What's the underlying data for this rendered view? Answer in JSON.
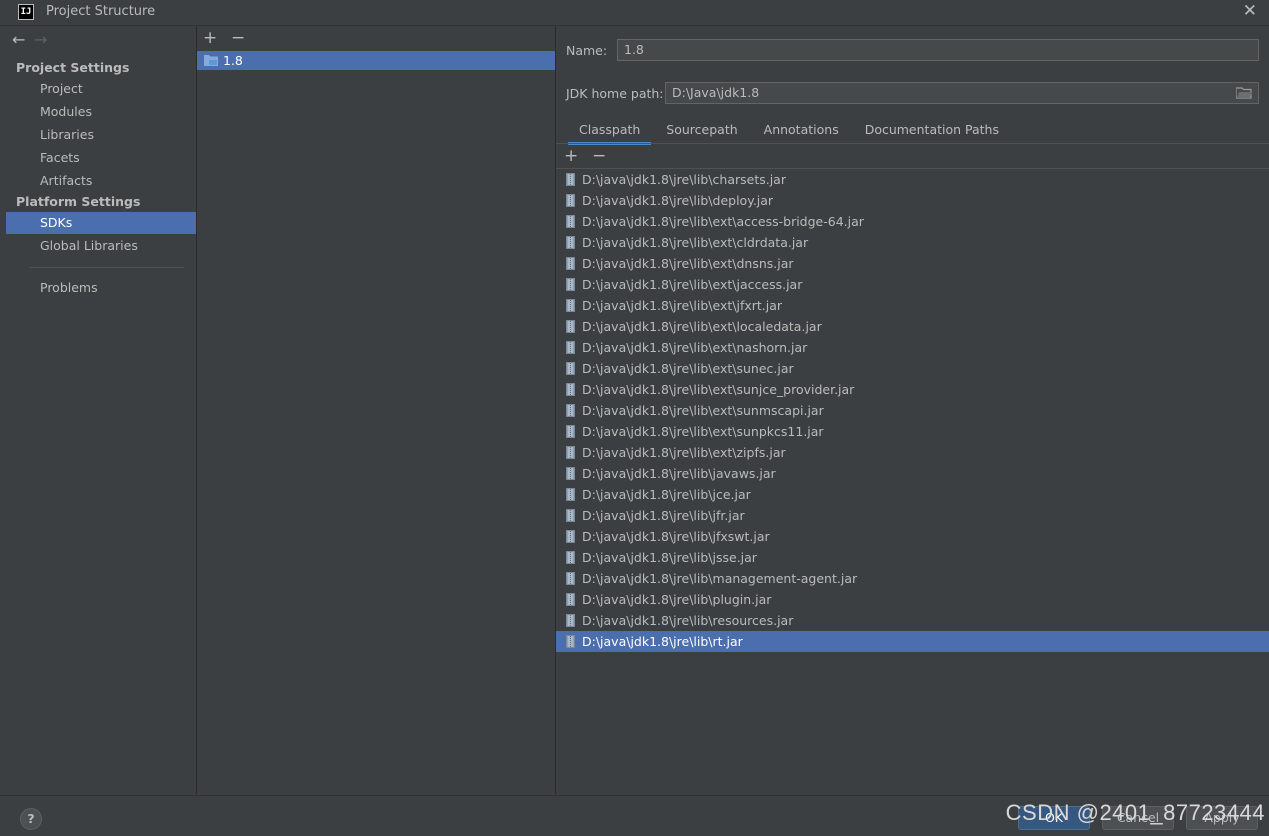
{
  "window": {
    "title": "Project Structure",
    "logo_text": "IJ"
  },
  "nav": {
    "back_glyph": "←",
    "forward_glyph": "→",
    "project_settings_header": "Project Settings",
    "project_items": [
      "Project",
      "Modules",
      "Libraries",
      "Facets",
      "Artifacts"
    ],
    "platform_settings_header": "Platform Settings",
    "platform_items": [
      "SDKs",
      "Global Libraries"
    ],
    "problems": "Problems",
    "selected": "SDKs"
  },
  "sdk_list": {
    "add": "+",
    "remove": "−",
    "items": [
      "1.8"
    ]
  },
  "detail": {
    "name_label": "Name:",
    "name_value": "1.8",
    "home_label": "JDK home path:",
    "home_value": "D:\\Java\\jdk1.8",
    "tabs": [
      "Classpath",
      "Sourcepath",
      "Annotations",
      "Documentation Paths"
    ],
    "active_tab": "Classpath",
    "add": "+",
    "remove": "−",
    "classpath": [
      "D:\\java\\jdk1.8\\jre\\lib\\charsets.jar",
      "D:\\java\\jdk1.8\\jre\\lib\\deploy.jar",
      "D:\\java\\jdk1.8\\jre\\lib\\ext\\access-bridge-64.jar",
      "D:\\java\\jdk1.8\\jre\\lib\\ext\\cldrdata.jar",
      "D:\\java\\jdk1.8\\jre\\lib\\ext\\dnsns.jar",
      "D:\\java\\jdk1.8\\jre\\lib\\ext\\jaccess.jar",
      "D:\\java\\jdk1.8\\jre\\lib\\ext\\jfxrt.jar",
      "D:\\java\\jdk1.8\\jre\\lib\\ext\\localedata.jar",
      "D:\\java\\jdk1.8\\jre\\lib\\ext\\nashorn.jar",
      "D:\\java\\jdk1.8\\jre\\lib\\ext\\sunec.jar",
      "D:\\java\\jdk1.8\\jre\\lib\\ext\\sunjce_provider.jar",
      "D:\\java\\jdk1.8\\jre\\lib\\ext\\sunmscapi.jar",
      "D:\\java\\jdk1.8\\jre\\lib\\ext\\sunpkcs11.jar",
      "D:\\java\\jdk1.8\\jre\\lib\\ext\\zipfs.jar",
      "D:\\java\\jdk1.8\\jre\\lib\\javaws.jar",
      "D:\\java\\jdk1.8\\jre\\lib\\jce.jar",
      "D:\\java\\jdk1.8\\jre\\lib\\jfr.jar",
      "D:\\java\\jdk1.8\\jre\\lib\\jfxswt.jar",
      "D:\\java\\jdk1.8\\jre\\lib\\jsse.jar",
      "D:\\java\\jdk1.8\\jre\\lib\\management-agent.jar",
      "D:\\java\\jdk1.8\\jre\\lib\\plugin.jar",
      "D:\\java\\jdk1.8\\jre\\lib\\resources.jar",
      "D:\\java\\jdk1.8\\jre\\lib\\rt.jar"
    ],
    "selected_index": 22
  },
  "footer": {
    "help": "?",
    "ok": "OK",
    "cancel": "Cancel",
    "apply": "Apply",
    "watermark": "CSDN @2401_87723444"
  },
  "colors": {
    "selection": "#4b6eaf",
    "background": "#3c3f41",
    "accent_tab": "#4a88c7"
  }
}
